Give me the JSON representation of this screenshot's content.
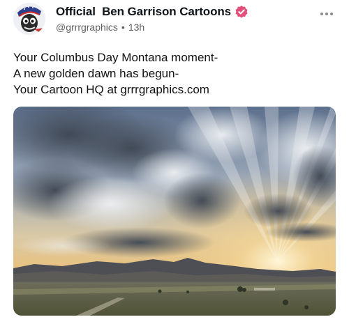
{
  "post": {
    "author": {
      "display_name": "Official  Ben Garrison Cartoons",
      "handle": "@grrrgraphics",
      "time": "13h",
      "separator": "•",
      "verified": true,
      "avatar_icon": "cartoon-avatar-icon",
      "verified_icon": "verified-badge-icon",
      "verified_color": "#e0507a"
    },
    "more_icon": "more-options-icon",
    "text_lines": [
      "Your Columbus Day Montana moment-",
      "A new golden dawn has begun-",
      "Your Cartoon HQ at grrrgraphics.com"
    ],
    "media": {
      "type": "photo",
      "subject": "sunrise-over-montana-landscape"
    }
  }
}
